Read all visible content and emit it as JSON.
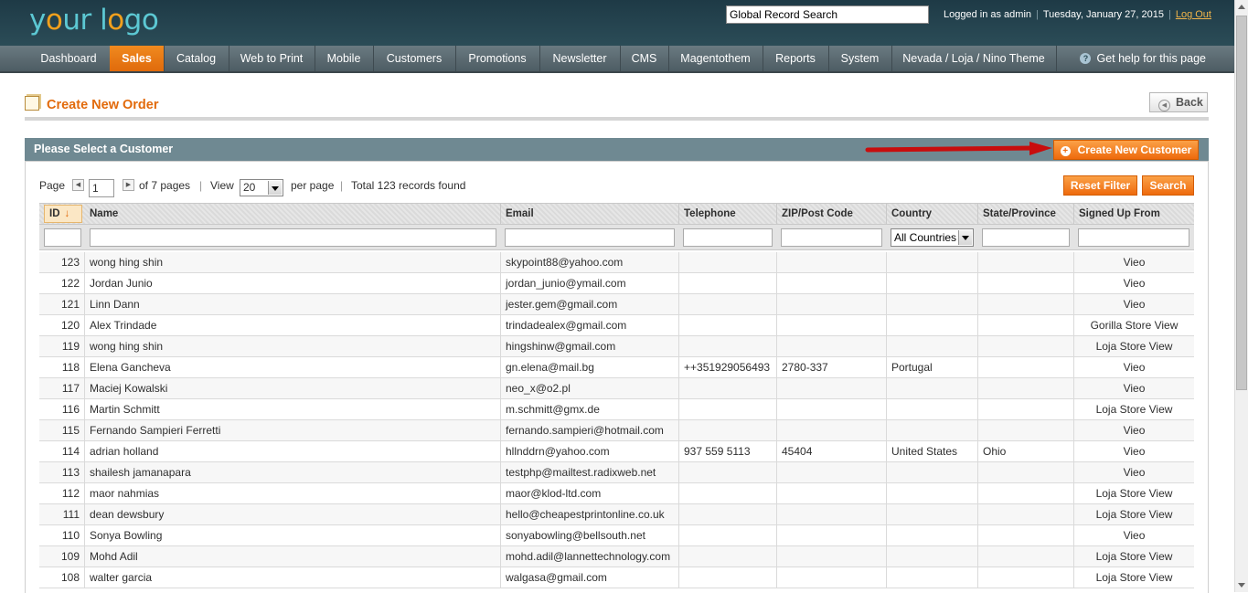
{
  "header": {
    "logo_text_1": "y",
    "logo_text_o": "o",
    "logo_text_2": "ur l",
    "logo_text_o2": "o",
    "logo_text_3": "go",
    "search_value": "Global Record Search",
    "logged_in": "Logged in as admin",
    "date": "Tuesday, January 27, 2015",
    "logout": "Log Out",
    "sep": "|"
  },
  "nav": {
    "items": [
      "Dashboard",
      "Sales",
      "Catalog",
      "Web to Print",
      "Mobile",
      "Customers",
      "Promotions",
      "Newsletter",
      "CMS",
      "Magentothem",
      "Reports",
      "System",
      "Nevada / Loja / Nino Theme"
    ],
    "active": "Sales",
    "help": "Get help for this page",
    "help_icon": "?"
  },
  "page": {
    "title": "Create New Order",
    "back": "Back",
    "panel_title": "Please Select a Customer",
    "create_customer": "Create New Customer",
    "reset_filter": "Reset Filter",
    "search": "Search"
  },
  "pager": {
    "page_label": "Page",
    "page_value": "1",
    "of_pages": "of 7 pages",
    "sep": "|",
    "view_label": "View",
    "view_value": "20",
    "per_page": "per page",
    "total": "Total 123 records found"
  },
  "grid": {
    "columns": [
      "ID",
      "Name",
      "Email",
      "Telephone",
      "ZIP/Post Code",
      "Country",
      "State/Province",
      "Signed Up From"
    ],
    "sort_arrow": "↓",
    "country_filter": "All Countries",
    "rows": [
      {
        "id": "123",
        "name": "wong hing shin",
        "email": "skypoint88@yahoo.com",
        "tel": "",
        "zip": "",
        "country": "",
        "state": "",
        "from": "Vieo"
      },
      {
        "id": "122",
        "name": "Jordan Junio",
        "email": "jordan_junio@ymail.com",
        "tel": "",
        "zip": "",
        "country": "",
        "state": "",
        "from": "Vieo"
      },
      {
        "id": "121",
        "name": "Linn Dann",
        "email": "jester.gem@gmail.com",
        "tel": "",
        "zip": "",
        "country": "",
        "state": "",
        "from": "Vieo"
      },
      {
        "id": "120",
        "name": "Alex Trindade",
        "email": "trindadealex@gmail.com",
        "tel": "",
        "zip": "",
        "country": "",
        "state": "",
        "from": "Gorilla Store View"
      },
      {
        "id": "119",
        "name": "wong hing shin",
        "email": "hingshinw@gmail.com",
        "tel": "",
        "zip": "",
        "country": "",
        "state": "",
        "from": "Loja Store View"
      },
      {
        "id": "118",
        "name": "Elena Gancheva",
        "email": "gn.elena@mail.bg",
        "tel": "++351929056493",
        "zip": "2780-337",
        "country": "Portugal",
        "state": "",
        "from": "Vieo"
      },
      {
        "id": "117",
        "name": "Maciej Kowalski",
        "email": "neo_x@o2.pl",
        "tel": "",
        "zip": "",
        "country": "",
        "state": "",
        "from": "Vieo"
      },
      {
        "id": "116",
        "name": "Martin Schmitt",
        "email": "m.schmitt@gmx.de",
        "tel": "",
        "zip": "",
        "country": "",
        "state": "",
        "from": "Loja Store View"
      },
      {
        "id": "115",
        "name": "Fernando Sampieri Ferretti",
        "email": "fernando.sampieri@hotmail.com",
        "tel": "",
        "zip": "",
        "country": "",
        "state": "",
        "from": "Vieo"
      },
      {
        "id": "114",
        "name": "adrian holland",
        "email": "hllnddrn@yahoo.com",
        "tel": "937 559 5113",
        "zip": "45404",
        "country": "United States",
        "state": "Ohio",
        "from": "Vieo"
      },
      {
        "id": "113",
        "name": "shailesh jamanapara",
        "email": "testphp@mailtest.radixweb.net",
        "tel": "",
        "zip": "",
        "country": "",
        "state": "",
        "from": "Vieo"
      },
      {
        "id": "112",
        "name": "maor nahmias",
        "email": "maor@klod-ltd.com",
        "tel": "",
        "zip": "",
        "country": "",
        "state": "",
        "from": "Loja Store View"
      },
      {
        "id": "111",
        "name": "dean dewsbury",
        "email": "hello@cheapestprintonline.co.uk",
        "tel": "",
        "zip": "",
        "country": "",
        "state": "",
        "from": "Loja Store View"
      },
      {
        "id": "110",
        "name": "Sonya Bowling",
        "email": "sonyabowling@bellsouth.net",
        "tel": "",
        "zip": "",
        "country": "",
        "state": "",
        "from": "Vieo"
      },
      {
        "id": "109",
        "name": "Mohd Adil",
        "email": "mohd.adil@lannettechnology.com",
        "tel": "",
        "zip": "",
        "country": "",
        "state": "",
        "from": "Loja Store View"
      },
      {
        "id": "108",
        "name": "walter garcia",
        "email": "walgasa@gmail.com",
        "tel": "",
        "zip": "",
        "country": "",
        "state": "",
        "from": "Loja Store View"
      }
    ]
  },
  "colors": {
    "accent": "#e26a0b",
    "header_bg": "#1e3a46",
    "panel_head": "#6f8992",
    "logo_teal": "#5cc8d3",
    "logo_orange": "#f1a01d",
    "arrow_red": "#e01010"
  },
  "icons": {
    "page": "document-icon",
    "back": "back-circle-icon",
    "plus": "plus-circle-icon",
    "help": "help-circle-icon",
    "arrow": "red-pointer-arrow"
  }
}
